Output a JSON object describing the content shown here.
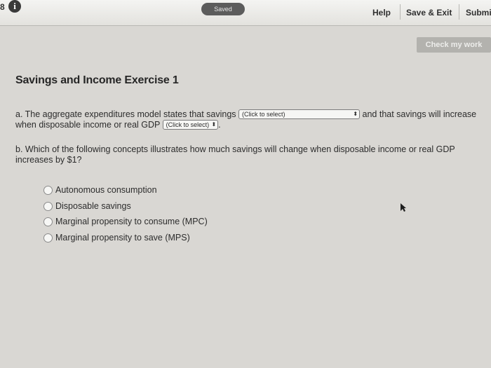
{
  "header": {
    "question_number": "8",
    "saved_label": "Saved",
    "help_label": "Help",
    "save_exit_label": "Save & Exit",
    "submit_label": "Submi"
  },
  "check_work_label": "Check my work",
  "exercise_title": "Savings and Income Exercise 1",
  "part_a": {
    "text_before": "a. The aggregate expenditures model states that savings",
    "select1_value": "(Click to select)",
    "text_middle": "and that savings will increase when disposable income or real GDP",
    "select2_value": "(Click to select)",
    "text_end": "."
  },
  "part_b": {
    "question": "b. Which of the following concepts illustrates how much savings will change when disposable income or real GDP increases by $1?",
    "options": [
      "Autonomous consumption",
      "Disposable savings",
      "Marginal propensity to consume (MPC)",
      "Marginal propensity to save (MPS)"
    ]
  }
}
